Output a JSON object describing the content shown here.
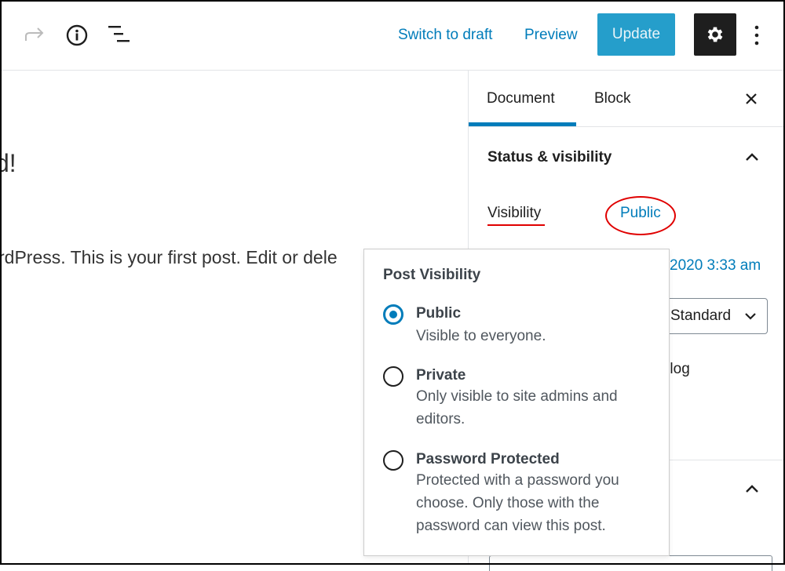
{
  "toolbar": {
    "switch_to_draft": "Switch to draft",
    "preview": "Preview",
    "update": "Update",
    "icons": [
      "redo-icon",
      "info-icon",
      "list-view-icon",
      "gear-icon",
      "more-vertical-icon"
    ]
  },
  "editor": {
    "title_fragment": "d!",
    "body_fragment": "rdPress. This is your first post. Edit or dele"
  },
  "sidebar": {
    "tabs": [
      {
        "label": "Document",
        "active": true
      },
      {
        "label": "Block",
        "active": false
      }
    ],
    "panel_title": "Status & visibility",
    "visibility_label": "Visibility",
    "visibility_value": "Public",
    "publish_date_fragment": "2020 3:33 am",
    "post_format_value": "Standard",
    "sticky_fragment": "e blog"
  },
  "popover": {
    "title": "Post Visibility",
    "options": [
      {
        "label": "Public",
        "description": "Visible to everyone.",
        "selected": true
      },
      {
        "label": "Private",
        "description": "Only visible to site admins and editors.",
        "selected": false
      },
      {
        "label": "Password Protected",
        "description": "Protected with a password you choose. Only those with the password can view this post.",
        "selected": false
      }
    ]
  },
  "colors": {
    "accent": "#007cba",
    "annotation": "#e00000",
    "dark": "#1e1e1e"
  }
}
